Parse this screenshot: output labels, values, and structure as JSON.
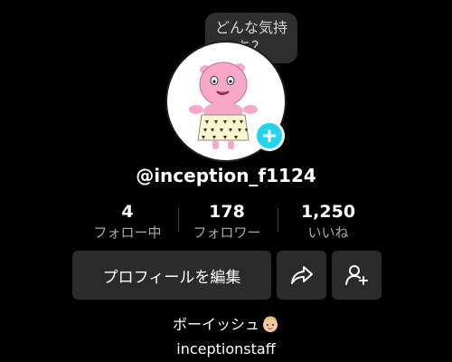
{
  "profile": {
    "bubble_line1": "どんな気持",
    "bubble_line2": "ち？",
    "username": "@inception_f1124",
    "bio": "ボーイッシュ",
    "bio_emoji": "boy-medium-light-skin-emoji",
    "link": "inceptionstaff"
  },
  "stats": {
    "following_count": "4",
    "following_label": "フォロー中",
    "followers_count": "178",
    "followers_label": "フォロワー",
    "likes_count": "1,250",
    "likes_label": "いいね"
  },
  "actions": {
    "edit_label": "プロフィールを編集",
    "share_icon": "share-arrow-icon",
    "add_friend_icon": "add-user-icon"
  },
  "colors": {
    "background": "#000000",
    "button_bg": "#2b2b2b",
    "add_badge": "#20d5ec",
    "secondary_text": "#a8a8a8"
  }
}
